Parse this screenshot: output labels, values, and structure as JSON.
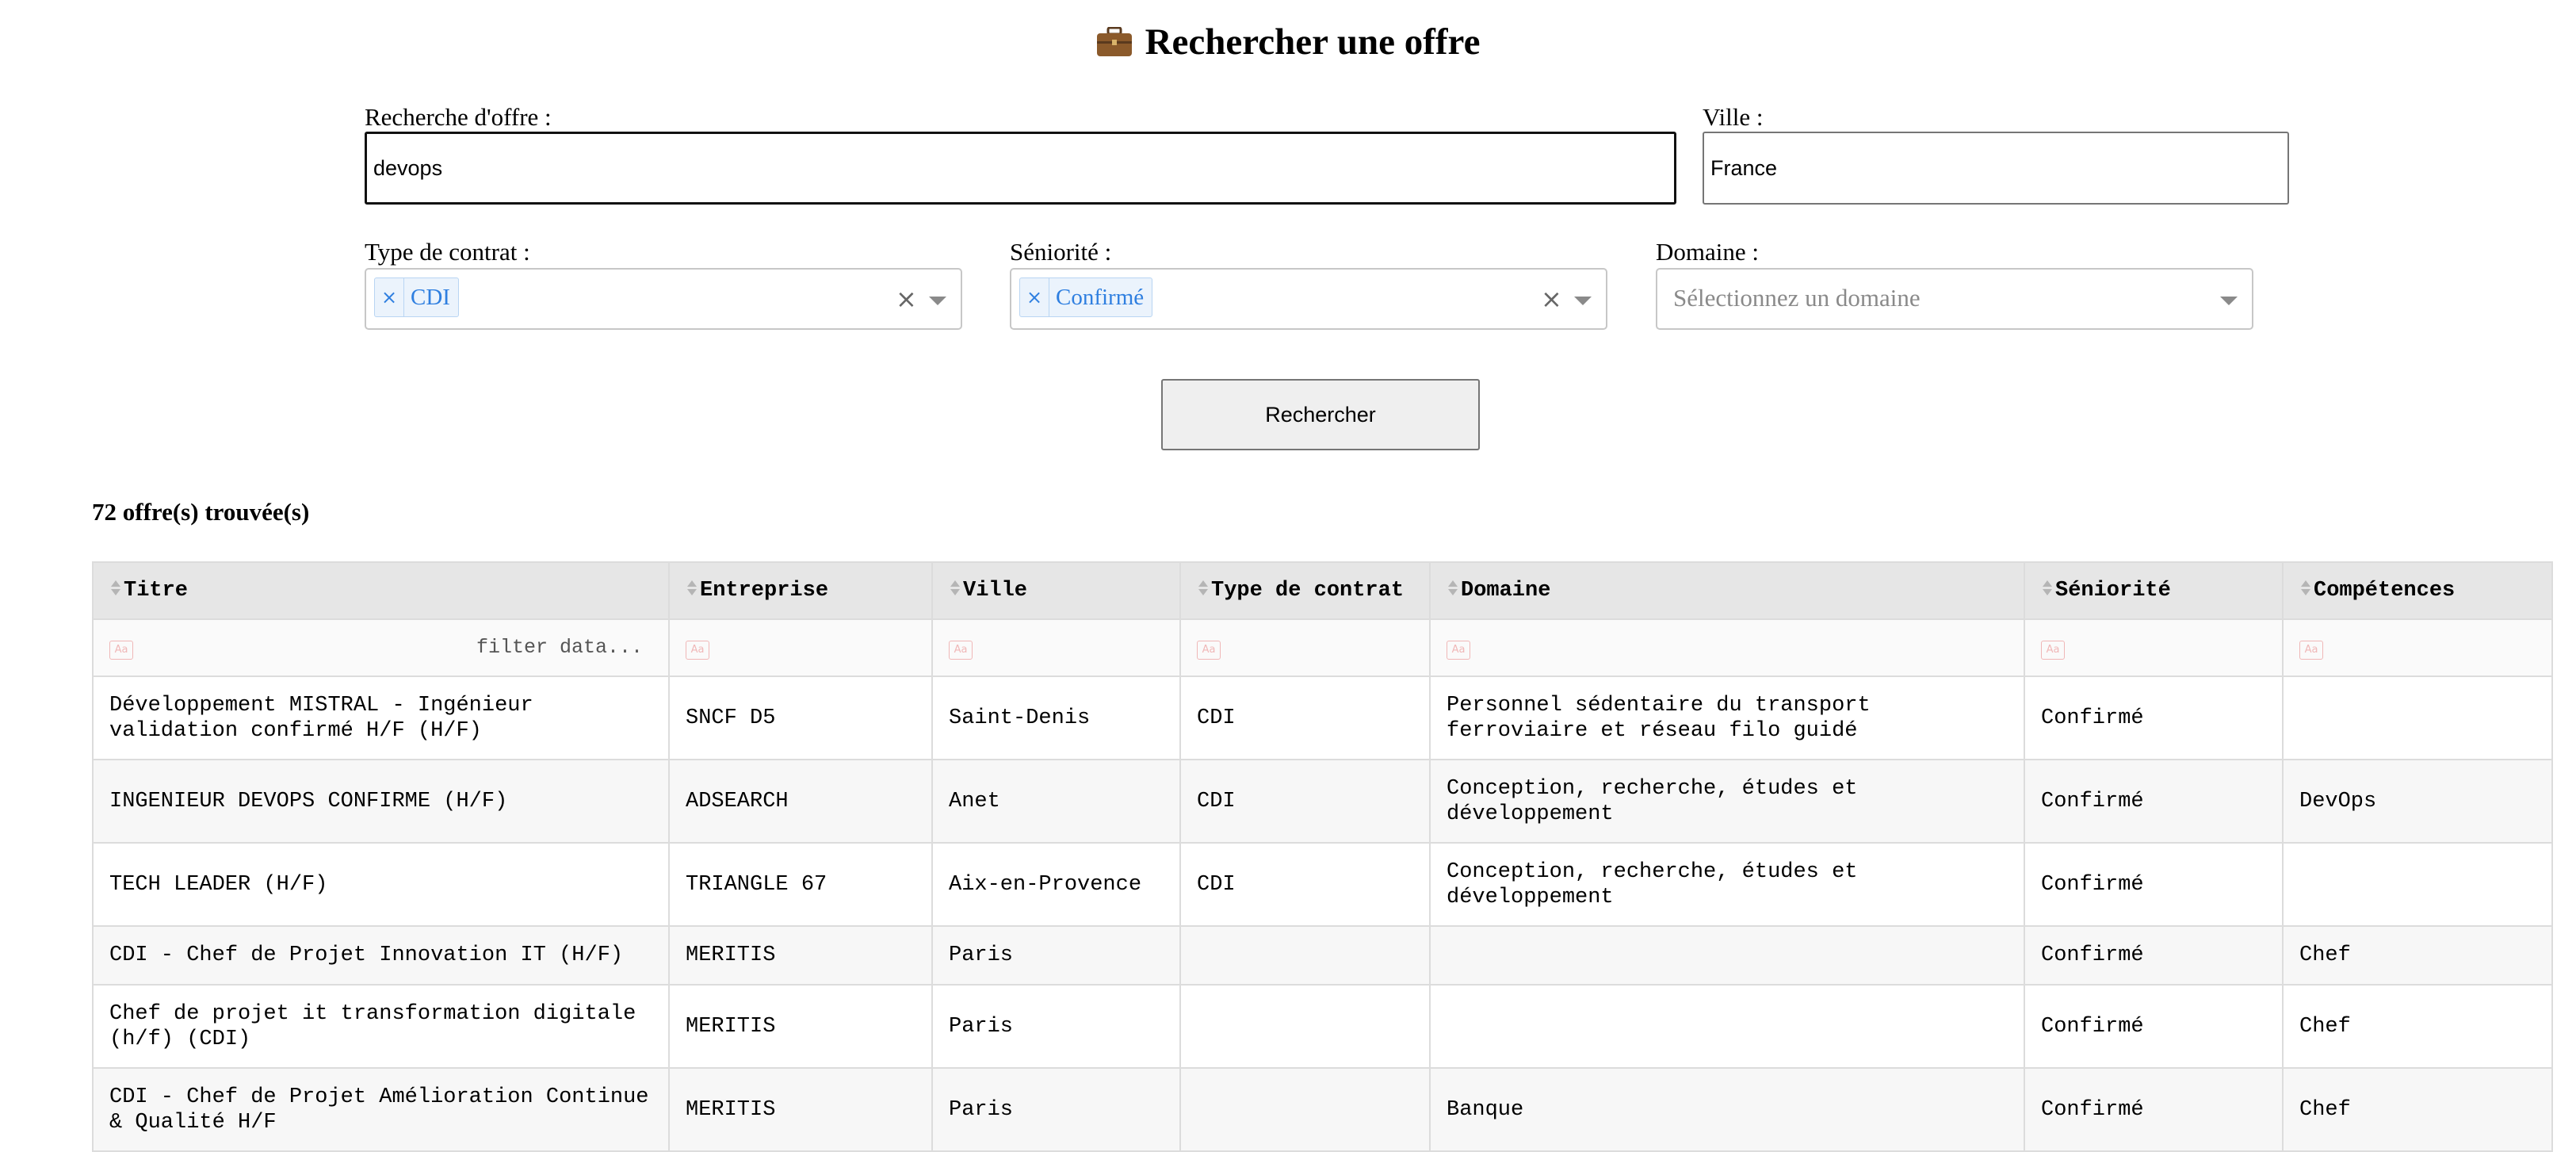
{
  "page": {
    "title_icon": "briefcase-icon",
    "title": "Rechercher une offre"
  },
  "form": {
    "search_label": "Recherche d'offre :",
    "search_value": "devops",
    "city_label": "Ville :",
    "city_value": "France",
    "contract_label": "Type de contrat :",
    "contract_selected": "CDI",
    "seniority_label": "Séniorité :",
    "seniority_selected": "Confirmé",
    "domain_label": "Domaine :",
    "domain_placeholder": "Sélectionnez un domaine",
    "remove_glyph": "×",
    "clear_glyph": "×",
    "submit_label": "Rechercher"
  },
  "results": {
    "count_text": "72 offre(s) trouvée(s)",
    "filter_placeholder": "filter data...",
    "filter_icon_text": "Aa",
    "columns": [
      "Titre",
      "Entreprise",
      "Ville",
      "Type de contrat",
      "Domaine",
      "Séniorité",
      "Compétences"
    ],
    "rows": [
      [
        "Développement MISTRAL - Ingénieur validation confirmé H/F (H/F)",
        "SNCF D5",
        "Saint-Denis",
        "CDI",
        "Personnel sédentaire du transport ferroviaire et réseau filo guidé",
        "Confirmé",
        ""
      ],
      [
        "INGENIEUR DEVOPS CONFIRME (H/F)",
        "ADSEARCH",
        "Anet",
        "CDI",
        "Conception, recherche, études et développement",
        "Confirmé",
        "DevOps"
      ],
      [
        "TECH LEADER (H/F)",
        "TRIANGLE 67",
        "Aix-en-Provence",
        "CDI",
        "Conception, recherche, études et développement",
        "Confirmé",
        ""
      ],
      [
        "CDI - Chef de Projet Innovation IT (H/F)",
        "MERITIS",
        "Paris",
        "",
        "",
        "Confirmé",
        "Chef"
      ],
      [
        "Chef de projet it transformation digitale (h/f) (CDI)",
        "MERITIS",
        "Paris",
        "",
        "",
        "Confirmé",
        "Chef"
      ],
      [
        "CDI - Chef de Projet Amélioration Continue & Qualité H/F",
        "MERITIS",
        "Paris",
        "",
        "Banque",
        "Confirmé",
        "Chef"
      ]
    ]
  },
  "colors": {
    "tag_bg": "#ebf3fc",
    "tag_text": "#2f7fe0",
    "header_bg": "#e6e6e6"
  }
}
